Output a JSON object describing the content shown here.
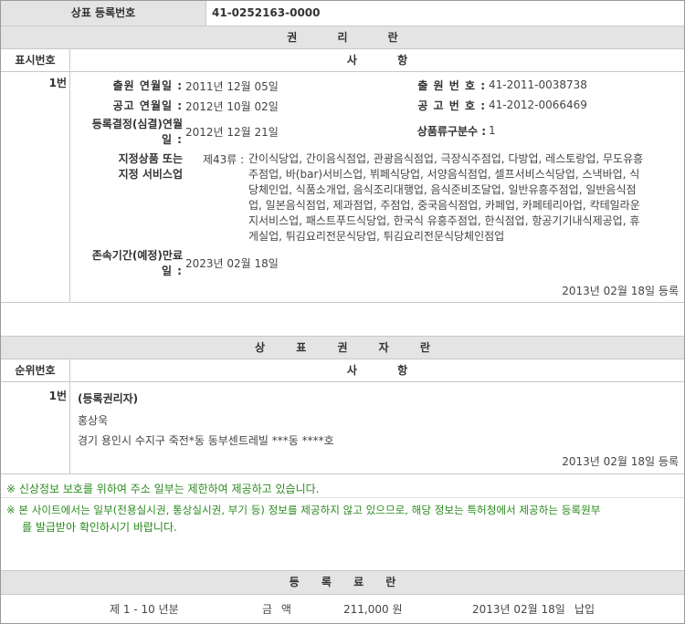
{
  "top": {
    "label": "상표 등록번호",
    "value": "41-0252163-0000"
  },
  "rights_section": {
    "title": "권 리 란",
    "col1": "표시번호",
    "col2": "사 항",
    "entry_no": "1번",
    "fields": {
      "app_date_label": "출원 연월일 :",
      "app_date_value": "2011년 12월 05일",
      "app_no_label": "출 원 번 호 :",
      "app_no_value": "41-2011-0038738",
      "pub_date_label": "공고 연월일 :",
      "pub_date_value": "2012년 10월 02일",
      "pub_no_label": "공 고 번 호 :",
      "pub_no_value": "41-2012-0066469",
      "decision_label_1": "등록결정(심결)연월",
      "decision_label_2": "일 :",
      "decision_value": "2012년 12월 21일",
      "class_count_label": "상품류구분수 :",
      "class_count_value": "1",
      "goods_label_1": "지정상품 또는",
      "goods_label_2": "지정 서비스업",
      "goods_class": "제43류 :",
      "goods_lines": [
        "간이식당업, 간이음식점업, 관광음식점업, 극장식주점업, 다방업, 레스토랑업, 무도유흥",
        "주점업, 바(bar)서비스업, 뷔페식당업, 서양음식점업, 셀프서비스식당업, 스낵바업, 식",
        "당체인업, 식품소개업, 음식조리대행업, 음식준비조달업, 일반유흥주점업, 일반음식점",
        "업, 일본음식점업, 제과점업, 주점업, 중국음식점업, 카페업, 카페테리아업, 칵테일라운",
        "지서비스업, 패스트푸드식당업, 한국식 유흥주점업, 한식점업, 항공기기내식제공업, 휴",
        "게실업, 튀김요리전문식당업, 튀김요리전문식당체인점업"
      ],
      "term_label_1": "존속기간(예정)만료",
      "term_label_2": "일 :",
      "term_value": "2023년 02월 18일"
    },
    "registered": "2013년 02월 18일 등록"
  },
  "owner_section": {
    "title": "상 표 권 자 란",
    "col1": "순위번호",
    "col2": "사 항",
    "entry_no": "1번",
    "role": "(등록권리자)",
    "name": "홍상욱",
    "address": "경기 용인시 수지구 죽전*동 동부센트레빌 ***동 ****호",
    "registered": "2013년 02월 18일 등록"
  },
  "notices": [
    "※ 신상정보 보호를 위하여 주소 일부는 제한하여 제공하고 있습니다.",
    "※ 본 사이트에서는 일부(전용실시권, 통상실시권, 부기 등) 정보를 제공하지 않고 있으므로, 해당 정보는 특허청에서 제공하는 등록원부",
    "를 발급받아 확인하시기 바랍니다."
  ],
  "fee_section": {
    "title": "등 록 료 란",
    "period": "제 1 - 10 년분",
    "amount_label": "금 액",
    "amount": "211,000 원",
    "date": "2013년 02월 18일",
    "status": "납입"
  },
  "colors": {
    "header_bg": "#e4e4e4",
    "border": "#c8c8c8",
    "notice_green": "#2a8a1e"
  }
}
